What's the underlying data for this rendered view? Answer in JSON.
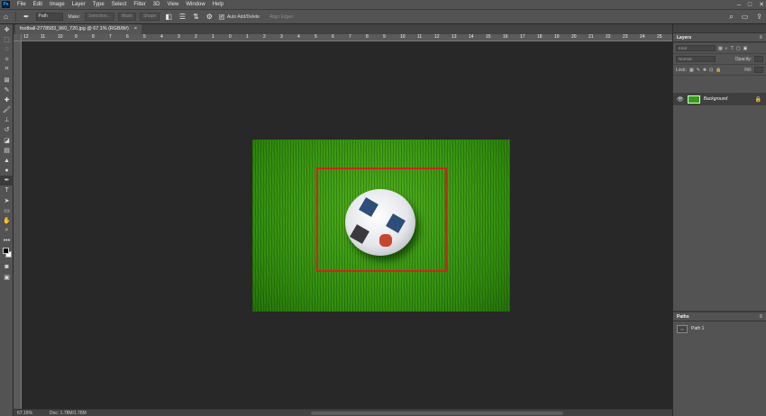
{
  "app": {
    "logo": "Ps"
  },
  "menu": [
    "File",
    "Edit",
    "Image",
    "Layer",
    "Type",
    "Select",
    "Filter",
    "3D",
    "View",
    "Window",
    "Help"
  ],
  "options": {
    "mode_select": "Path",
    "make_label": "Make:",
    "selection_btn": "Selection...",
    "mask_btn": "Mask",
    "shape_btn": "Shape",
    "auto_add_delete": "Auto Add/Delete",
    "auto_checked": true,
    "align_edges": "Align Edges"
  },
  "document": {
    "tab_title": "football-2778583_960_720.jpg @ 67.1% (RGB/8#)",
    "ruler_numbers": [
      "12",
      "11",
      "10",
      "9",
      "8",
      "7",
      "6",
      "5",
      "4",
      "3",
      "2",
      "1",
      "0",
      "1",
      "2",
      "3",
      "4",
      "5",
      "6",
      "7",
      "8",
      "9",
      "10",
      "11",
      "12",
      "13",
      "14",
      "15",
      "16",
      "17",
      "18",
      "19",
      "20",
      "21",
      "22",
      "23",
      "24",
      "25"
    ]
  },
  "status": {
    "zoom": "67.15%",
    "doc": "Doc: 1.78M/1.78M"
  },
  "layers_panel": {
    "title": "Layers",
    "filter_placeholder": "Kind",
    "blend_mode": "Normal",
    "opacity_label": "Opacity:",
    "lock_label": "Lock:",
    "fill_label": "Fill:",
    "layers": [
      {
        "name": "Background",
        "visible": true,
        "locked": true
      }
    ]
  },
  "paths_panel": {
    "title": "Paths",
    "paths": [
      {
        "name": "Path 1"
      }
    ]
  },
  "colors": {
    "selection_outline": "#d2231b",
    "grass": "#3d9a16"
  }
}
